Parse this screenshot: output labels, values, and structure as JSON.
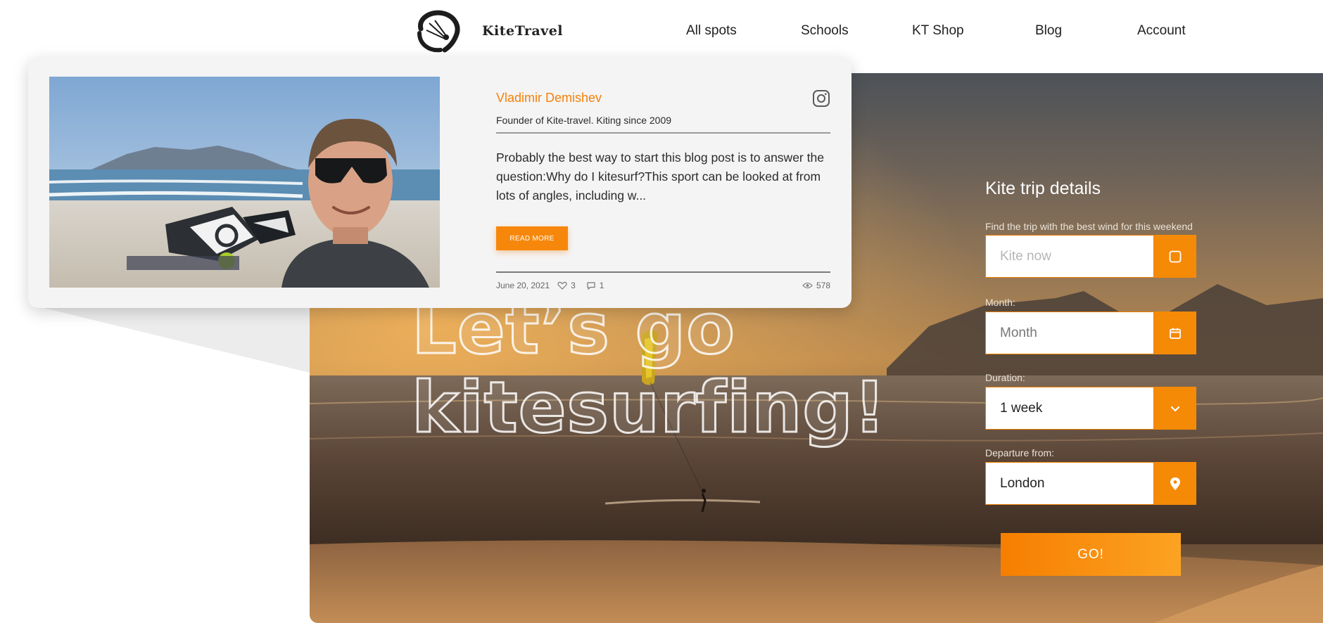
{
  "header": {
    "brand": "KiteTravel",
    "nav": [
      "All spots",
      "Schools",
      "KT Shop",
      "Blog",
      "Account"
    ]
  },
  "hero": {
    "title_line1": "Let’s go",
    "title_line2": "kitesurfing!"
  },
  "trip_form": {
    "title": "Kite trip details",
    "hint": "Find the trip with the best wind for this weekend",
    "kite_now_placeholder": "Kite now",
    "month_label": "Month:",
    "month_placeholder": "Month",
    "duration_label": "Duration:",
    "duration_value": "1 week",
    "departure_label": "Departure from:",
    "departure_value": "London",
    "go_label": "GO!"
  },
  "blog_card": {
    "author": "Vladimir Demishev",
    "role": "Founder of Kite-travel. Kiting since 2009",
    "excerpt": "Probably the best way to start this blog post is to answer the question:Why do I kitesurf?This sport can be looked at from lots of angles, including w...",
    "read_more": "READ MORE",
    "date": "June 20, 2021",
    "likes": "3",
    "comments": "1",
    "views": "578"
  },
  "colors": {
    "accent": "#f58a07",
    "author": "#f4810a",
    "card_bg": "#f4f4f4"
  }
}
